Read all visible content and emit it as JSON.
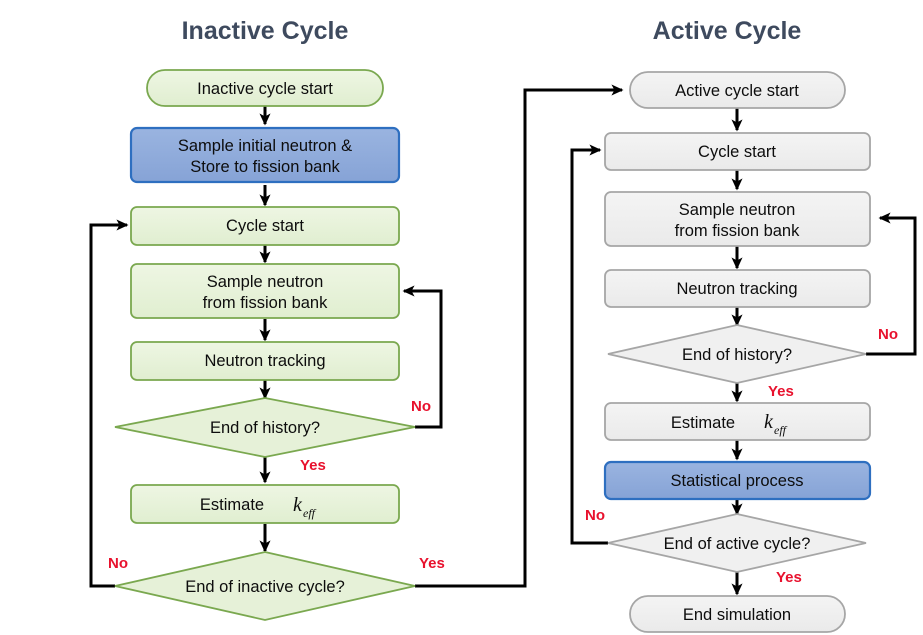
{
  "diagram": {
    "title_left": "Inactive Cycle",
    "title_right": "Active Cycle",
    "colors": {
      "title_text": "#3e4a5e",
      "green_fill": "#e8f2dc",
      "green_stroke": "#7aa84f",
      "blue_fill": "#8faadc",
      "blue_stroke": "#2e6fc0",
      "gray_fill": "#f0f0f0",
      "gray_stroke": "#a6a6a6",
      "edge_label": "#e8112d",
      "connector": "#000000"
    }
  },
  "inactive_cycle": {
    "nodes": [
      {
        "id": "inactive-cycle-start",
        "label": "Inactive cycle start",
        "shape": "terminator",
        "style": "green"
      },
      {
        "id": "sample-initial-neutron",
        "label_line1": "Sample initial neutron &",
        "label_line2": "Store to fission bank",
        "shape": "process",
        "style": "blue"
      },
      {
        "id": "cycle-start",
        "label": "Cycle start",
        "shape": "process",
        "style": "green"
      },
      {
        "id": "sample-neutron",
        "label_line1": "Sample neutron",
        "label_line2": "from fission bank",
        "shape": "process",
        "style": "green"
      },
      {
        "id": "neutron-tracking",
        "label": "Neutron tracking",
        "shape": "process",
        "style": "green"
      },
      {
        "id": "end-of-history",
        "label": "End of history?",
        "shape": "decision",
        "style": "green"
      },
      {
        "id": "estimate-keff",
        "label": "Estimate",
        "symbol": "k",
        "symbol_subscript": "eff",
        "shape": "process",
        "style": "green"
      },
      {
        "id": "end-of-inactive-cycle",
        "label": "End of inactive cycle?",
        "shape": "decision",
        "style": "green"
      }
    ],
    "edge_labels": {
      "history_no": "No",
      "history_yes": "Yes",
      "inactive_cycle_no": "No",
      "inactive_cycle_yes": "Yes"
    }
  },
  "active_cycle": {
    "nodes": [
      {
        "id": "active-cycle-start",
        "label": "Active cycle start",
        "shape": "terminator",
        "style": "gray"
      },
      {
        "id": "cycle-start",
        "label": "Cycle start",
        "shape": "process",
        "style": "gray"
      },
      {
        "id": "sample-neutron",
        "label_line1": "Sample neutron",
        "label_line2": "from fission bank",
        "shape": "process",
        "style": "gray"
      },
      {
        "id": "neutron-tracking",
        "label": "Neutron tracking",
        "shape": "process",
        "style": "gray"
      },
      {
        "id": "end-of-history",
        "label": "End of history?",
        "shape": "decision",
        "style": "gray"
      },
      {
        "id": "estimate-keff",
        "label": "Estimate",
        "symbol": "k",
        "symbol_subscript": "eff",
        "shape": "process",
        "style": "gray"
      },
      {
        "id": "statistical-process",
        "label": "Statistical process",
        "shape": "process",
        "style": "blue"
      },
      {
        "id": "end-of-active-cycle",
        "label": "End of active cycle?",
        "shape": "decision",
        "style": "gray"
      },
      {
        "id": "end-simulation",
        "label": "End simulation",
        "shape": "terminator",
        "style": "gray"
      }
    ],
    "edge_labels": {
      "history_no": "No",
      "history_yes": "Yes",
      "active_cycle_no": "No",
      "active_cycle_yes": "Yes"
    }
  }
}
